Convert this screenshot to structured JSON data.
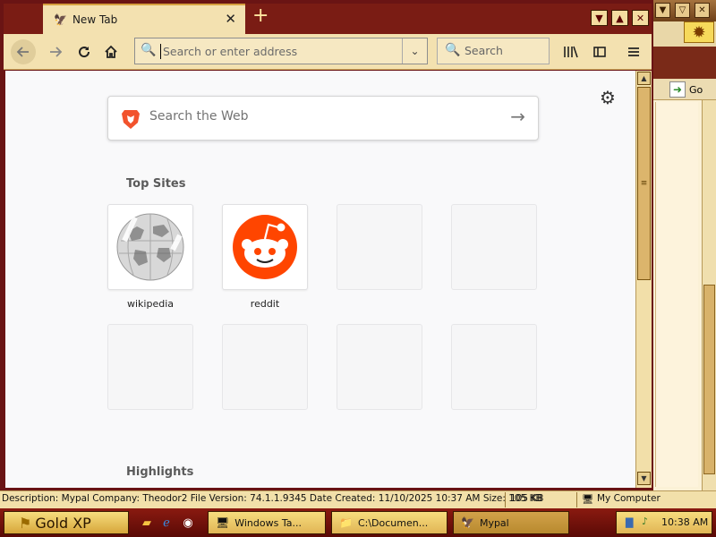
{
  "browser": {
    "tab_title": "New Tab",
    "urlbar_placeholder": "Search or enter address",
    "searchbar_placeholder": "Search"
  },
  "newtab": {
    "web_search_placeholder": "Search the Web",
    "top_sites_title": "Top Sites",
    "highlights_title": "Highlights",
    "sites": [
      {
        "label": "wikipedia"
      },
      {
        "label": "reddit"
      }
    ]
  },
  "background_window": {
    "go_label": "Go"
  },
  "statusbar": {
    "description": "Description: Mypal Company: Theodor2 File Version: 74.1.1.9345 Date Created: 11/10/2025 10:37 AM Size: 105 KB",
    "size": "105 KB",
    "location": "My Computer"
  },
  "taskbar": {
    "start_label": "Gold XP",
    "tasks": [
      {
        "label": "Windows Ta..."
      },
      {
        "label": "C:\\Documen..."
      },
      {
        "label": "Mypal"
      }
    ],
    "clock": "10:38 AM"
  },
  "colors": {
    "reddit_orange": "#ff4500",
    "brave_orange": "#f2532d",
    "frame_maroon": "#6a1414",
    "chrome_beige": "#f3e1b0"
  }
}
